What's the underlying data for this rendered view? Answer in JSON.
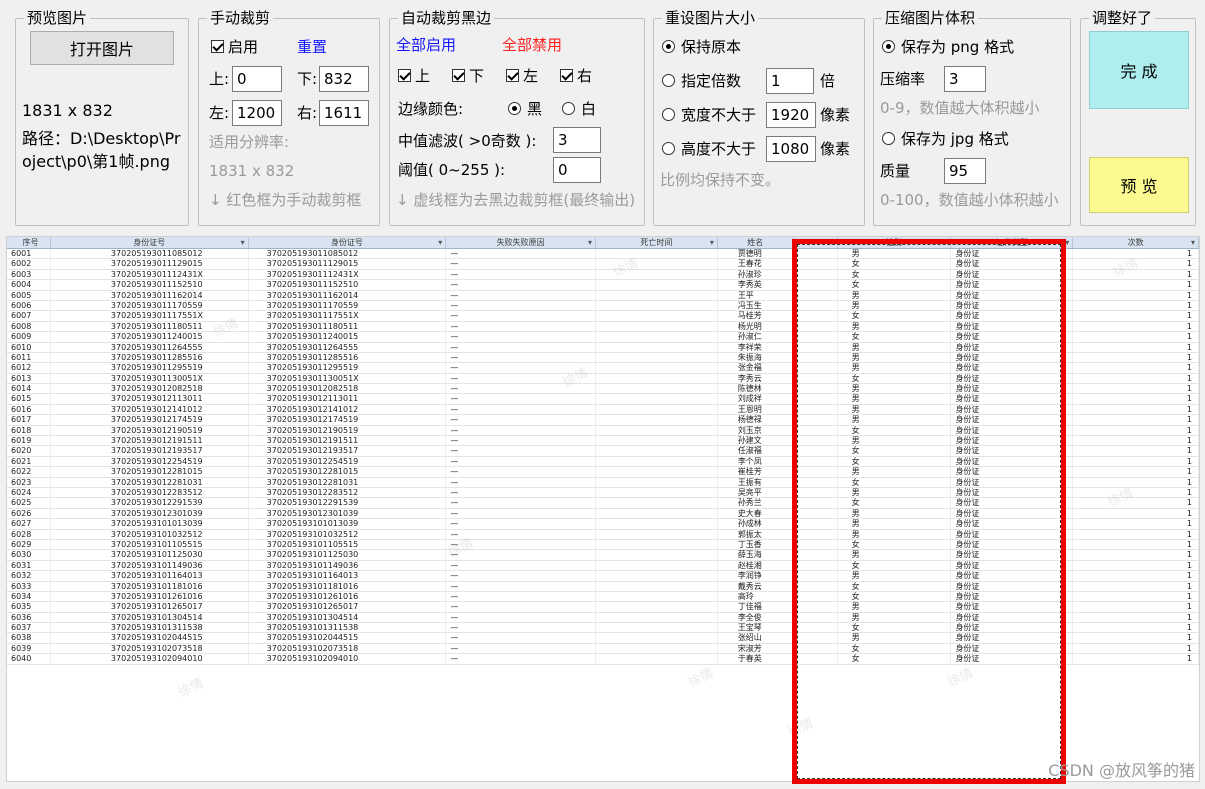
{
  "preview_group": {
    "title": "预览图片",
    "open_button": "打开图片",
    "size": "1831 x 832",
    "path_line1": "路径：D:\\Desktop\\Pr",
    "path_line2": "oject\\p0\\第1帧.png"
  },
  "manual_crop": {
    "title": "手动裁剪",
    "enable_label": "启用",
    "enable_checked": true,
    "reset_label": "重置",
    "top_label": "上:",
    "top_value": "0",
    "bottom_label": "下:",
    "bottom_value": "832",
    "left_label": "左:",
    "left_value": "1200",
    "right_label": "右:",
    "right_value": "1611",
    "resolution_label": "适用分辨率:",
    "resolution_value": "1831 x 832",
    "hint": "↓ 红色框为手动裁剪框"
  },
  "auto_crop": {
    "title": "自动裁剪黑边",
    "enable_all": "全部启用",
    "disable_all": "全部禁用",
    "top_label": "上",
    "bottom_label": "下",
    "left_label": "左",
    "right_label": "右",
    "edge_color_label": "边缘颜色:",
    "black_label": "黑",
    "white_label": "白",
    "median_label": "中值滤波( >0奇数 ):",
    "median_value": "3",
    "threshold_label": "阈值( 0~255 ):",
    "threshold_value": "0",
    "hint": "↓ 虚线框为去黑边裁剪框(最终输出)"
  },
  "resize": {
    "title": "重设图片大小",
    "keep_original": "保持原本",
    "specify_multiple": "指定倍数",
    "multiple_value": "1",
    "multiple_unit": "倍",
    "width_max": "宽度不大于",
    "width_value": "1920",
    "height_max": "高度不大于",
    "height_value": "1080",
    "pixel_unit": "像素",
    "hint": "比例均保持不变。"
  },
  "compress": {
    "title": "压缩图片体积",
    "png_label": "保存为 png 格式",
    "ratio_label": "压缩率",
    "ratio_value": "3",
    "ratio_hint": "0-9，数值越大体积越小",
    "jpg_label": "保存为 jpg 格式",
    "quality_label": "质量",
    "quality_value": "95",
    "quality_hint": "0-100，数值越小体积越小"
  },
  "finish_group": {
    "title": "调整好了",
    "done_button": "完 成",
    "preview_button": "预 览"
  },
  "table": {
    "headers": [
      "序号",
      "身份证号",
      "身份证号",
      "失败失败原因",
      "死亡时间",
      "姓名",
      "性别",
      "证件类型",
      "次数"
    ],
    "rows": [
      [
        "6001",
        "370205193011085012",
        "370205193011085012",
        "—",
        "",
        "贾德明",
        "男",
        "身份证",
        "1"
      ],
      [
        "6002",
        "370205193011129015",
        "370205193011129015",
        "—",
        "",
        "王春花",
        "女",
        "身份证",
        "1"
      ],
      [
        "6003",
        "37020519301112431X",
        "37020519301112431X",
        "—",
        "",
        "孙淑珍",
        "女",
        "身份证",
        "1"
      ],
      [
        "6004",
        "370205193011152510",
        "370205193011152510",
        "—",
        "",
        "李秀英",
        "女",
        "身份证",
        "1"
      ],
      [
        "6005",
        "370205193011162014",
        "370205193011162014",
        "—",
        "",
        "王平",
        "男",
        "身份证",
        "1"
      ],
      [
        "6006",
        "370205193011170559",
        "370205193011170559",
        "—",
        "",
        "冯玉生",
        "男",
        "身份证",
        "1"
      ],
      [
        "6007",
        "37020519301117551X",
        "37020519301117551X",
        "—",
        "",
        "马桂芳",
        "女",
        "身份证",
        "1"
      ],
      [
        "6008",
        "370205193011180511",
        "370205193011180511",
        "—",
        "",
        "杨光明",
        "男",
        "身份证",
        "1"
      ],
      [
        "6009",
        "370205193011240015",
        "370205193011240015",
        "—",
        "",
        "孙淑仁",
        "女",
        "身份证",
        "1"
      ],
      [
        "6010",
        "370205193011264555",
        "370205193011264555",
        "—",
        "",
        "李祥荣",
        "男",
        "身份证",
        "1"
      ],
      [
        "6011",
        "370205193011285516",
        "370205193011285516",
        "—",
        "",
        "朱振海",
        "男",
        "身份证",
        "1"
      ],
      [
        "6012",
        "370205193011295519",
        "370205193011295519",
        "—",
        "",
        "张金福",
        "男",
        "身份证",
        "1"
      ],
      [
        "6013",
        "37020519301130051X",
        "37020519301130051X",
        "—",
        "",
        "李秀云",
        "女",
        "身份证",
        "1"
      ],
      [
        "6014",
        "370205193012082518",
        "370205193012082518",
        "—",
        "",
        "陈德林",
        "男",
        "身份证",
        "1"
      ],
      [
        "6015",
        "370205193012113011",
        "370205193012113011",
        "—",
        "",
        "刘成祥",
        "男",
        "身份证",
        "1"
      ],
      [
        "6016",
        "370205193012141012",
        "370205193012141012",
        "—",
        "",
        "王恩明",
        "男",
        "身份证",
        "1"
      ],
      [
        "6017",
        "370205193012174519",
        "370205193012174519",
        "—",
        "",
        "杨德禄",
        "男",
        "身份证",
        "1"
      ],
      [
        "6018",
        "370205193012190519",
        "370205193012190519",
        "—",
        "",
        "刘玉京",
        "女",
        "身份证",
        "1"
      ],
      [
        "6019",
        "370205193012191511",
        "370205193012191511",
        "—",
        "",
        "孙建文",
        "男",
        "身份证",
        "1"
      ],
      [
        "6020",
        "370205193012193517",
        "370205193012193517",
        "—",
        "",
        "任淑福",
        "女",
        "身份证",
        "1"
      ],
      [
        "6021",
        "370205193012254519",
        "370205193012254519",
        "—",
        "",
        "李个凤",
        "女",
        "身份证",
        "1"
      ],
      [
        "6022",
        "370205193012281015",
        "370205193012281015",
        "—",
        "",
        "崔桂芳",
        "男",
        "身份证",
        "1"
      ],
      [
        "6023",
        "370205193012281031",
        "370205193012281031",
        "—",
        "",
        "王振有",
        "女",
        "身份证",
        "1"
      ],
      [
        "6024",
        "370205193012283512",
        "370205193012283512",
        "—",
        "",
        "吴亮平",
        "男",
        "身份证",
        "1"
      ],
      [
        "6025",
        "370205193012291539",
        "370205193012291539",
        "—",
        "",
        "孙秀兰",
        "女",
        "身份证",
        "1"
      ],
      [
        "6026",
        "370205193012301039",
        "370205193012301039",
        "—",
        "",
        "史大春",
        "男",
        "身份证",
        "1"
      ],
      [
        "6027",
        "370205193101013039",
        "370205193101013039",
        "—",
        "",
        "孙成林",
        "男",
        "身份证",
        "1"
      ],
      [
        "6028",
        "370205193101032512",
        "370205193101032512",
        "—",
        "",
        "郭振太",
        "男",
        "身份证",
        "1"
      ],
      [
        "6029",
        "370205193101105515",
        "370205193101105515",
        "—",
        "",
        "丁玉香",
        "女",
        "身份证",
        "1"
      ],
      [
        "6030",
        "370205193101125030",
        "370205193101125030",
        "—",
        "",
        "薛玉海",
        "男",
        "身份证",
        "1"
      ],
      [
        "6031",
        "370205193101149036",
        "370205193101149036",
        "—",
        "",
        "赵桂湘",
        "女",
        "身份证",
        "1"
      ],
      [
        "6032",
        "370205193101164013",
        "370205193101164013",
        "—",
        "",
        "李润铮",
        "男",
        "身份证",
        "1"
      ],
      [
        "6033",
        "370205193101181016",
        "370205193101181016",
        "—",
        "",
        "戴秀云",
        "女",
        "身份证",
        "1"
      ],
      [
        "6034",
        "370205193101261016",
        "370205193101261016",
        "—",
        "",
        "高玲",
        "女",
        "身份证",
        "1"
      ],
      [
        "6035",
        "370205193101265017",
        "370205193101265017",
        "—",
        "",
        "丁佳福",
        "男",
        "身份证",
        "1"
      ],
      [
        "6036",
        "370205193101304514",
        "370205193101304514",
        "—",
        "",
        "李全俊",
        "男",
        "身份证",
        "1"
      ],
      [
        "6037",
        "370205193101311538",
        "370205193101311538",
        "—",
        "",
        "王宝琴",
        "女",
        "身份证",
        "1"
      ],
      [
        "6038",
        "370205193102044515",
        "370205193102044515",
        "—",
        "",
        "张绍山",
        "男",
        "身份证",
        "1"
      ],
      [
        "6039",
        "370205193102073518",
        "370205193102073518",
        "—",
        "",
        "宋淑芳",
        "女",
        "身份证",
        "1"
      ],
      [
        "6040",
        "370205193102094010",
        "370205193102094010",
        "—",
        "",
        "于春英",
        "女",
        "身份证",
        "1"
      ]
    ]
  },
  "watermark": "CSDN @放风筝的猪",
  "colors": {
    "done_button": "#aeeeee",
    "preview_button": "#fafa90",
    "crop_box": "#ee0000",
    "link_blue": "#1414ff",
    "link_red": "#ff2020"
  }
}
